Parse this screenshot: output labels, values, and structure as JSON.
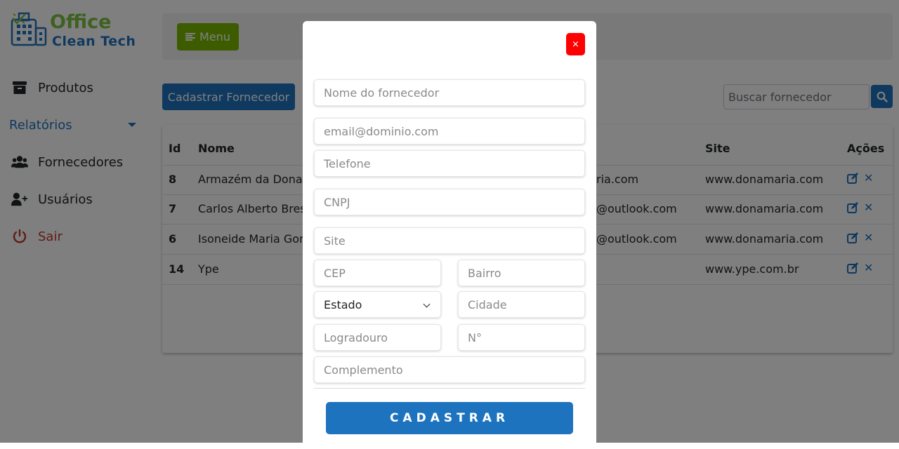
{
  "brand": {
    "line1": "Office",
    "line2": "Clean Tech"
  },
  "sidebar": {
    "items": [
      {
        "label": "Produtos",
        "icon": "archive-icon"
      },
      {
        "label": "Relatórios",
        "icon": "chevron-down-icon"
      },
      {
        "label": "Fornecedores",
        "icon": "users-icon"
      },
      {
        "label": "Usuários",
        "icon": "user-plus-icon"
      },
      {
        "label": "Sair",
        "icon": "power-icon"
      }
    ]
  },
  "header": {
    "menu_label": "Menu"
  },
  "toolbar": {
    "register_label": "Cadastrar Fornecedor",
    "search_placeholder": "Buscar fornecedor"
  },
  "table": {
    "headers": {
      "id": "Id",
      "nome": "Nome",
      "site": "Site",
      "acoes": "Ações"
    },
    "rows": [
      {
        "id": "8",
        "nome": "Armazém da Dona I",
        "email": "ria.com",
        "site": "www.donamaria.com"
      },
      {
        "id": "7",
        "nome": "Carlos Alberto Bres",
        "email": "@outlook.com",
        "site": "www.donamaria.com"
      },
      {
        "id": "6",
        "nome": "Isoneide Maria Gom",
        "email": "@outlook.com",
        "site": "www.donamaria.com"
      },
      {
        "id": "14",
        "nome": "Ype",
        "email": "",
        "site": "www.ype.com.br"
      }
    ]
  },
  "modal": {
    "close_label": "×",
    "fields": {
      "nome": "Nome do fornecedor",
      "email": "email@dominio.com",
      "telefone": "Telefone",
      "cnpj": "CNPJ",
      "site": "Site",
      "cep": "CEP",
      "bairro": "Bairro",
      "estado": "Estado",
      "cidade": "Cidade",
      "logradouro": "Logradouro",
      "numero": "N°",
      "complemento": "Complemento"
    },
    "submit_label": "CADASTRAR"
  },
  "colors": {
    "primary": "#1e73be",
    "brand_green": "#7cc242",
    "menu_green": "#7ab800",
    "danger": "#ff0000",
    "logout": "#c0392b"
  }
}
